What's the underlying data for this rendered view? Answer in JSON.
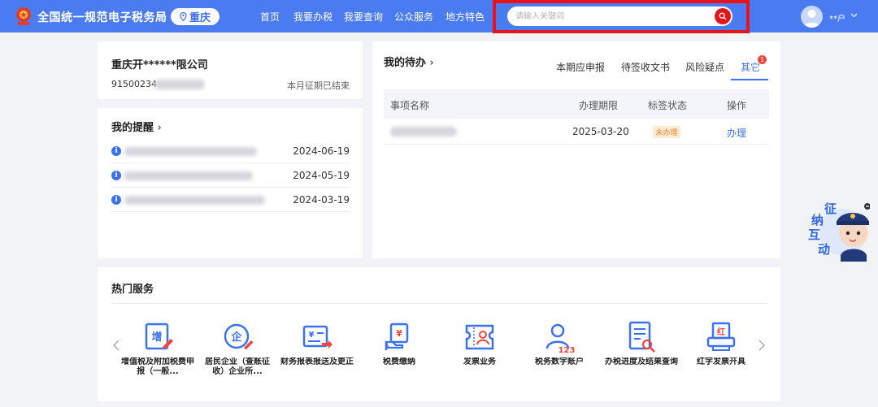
{
  "header": {
    "site_title": "全国统一规范电子税务局",
    "region": "重庆",
    "nav": [
      "首页",
      "我要办税",
      "我要查询",
      "公众服务",
      "地方特色"
    ],
    "search_placeholder": "请输入关键词",
    "user_name": "**户"
  },
  "company": {
    "name": "重庆开******限公司",
    "tax_id_prefix": "91500234",
    "period_status": "本月征期已结束"
  },
  "reminders": {
    "title": "我的提醒",
    "items": [
      {
        "date": "2024-06-19"
      },
      {
        "date": "2024-05-19"
      },
      {
        "date": "2024-03-19"
      }
    ]
  },
  "todo": {
    "title": "我的待办",
    "tabs": [
      "本期应申报",
      "待签收文书",
      "风险疑点",
      "其它"
    ],
    "active_tab": "其它",
    "badge_count": "1",
    "columns": [
      "事项名称",
      "办理期限",
      "标签状态",
      "操作"
    ],
    "rows": [
      {
        "deadline": "2025-03-20",
        "status": "未办理",
        "action": "办理"
      }
    ]
  },
  "hot_services": {
    "title": "热门服务",
    "items": [
      {
        "label": "增值税及附加税费申报（一般...",
        "icon": "vat-declaration-icon"
      },
      {
        "label": "居民企业（查账征收）企业所...",
        "icon": "enterprise-income-tax-icon"
      },
      {
        "label": "财务报表报送及更正",
        "icon": "financial-report-icon"
      },
      {
        "label": "税费缴纳",
        "icon": "tax-payment-icon"
      },
      {
        "label": "发票业务",
        "icon": "invoice-business-icon"
      },
      {
        "label": "税务数字账户",
        "icon": "digital-account-icon"
      },
      {
        "label": "办税进度及结果查询",
        "icon": "progress-query-icon"
      },
      {
        "label": "红字发票开具",
        "icon": "red-invoice-icon"
      }
    ]
  },
  "float_widget": {
    "label": "征纳互动"
  },
  "colors": {
    "header": "#4a7bf0",
    "accent": "#3c72f1",
    "highlight": "#e8141c"
  }
}
